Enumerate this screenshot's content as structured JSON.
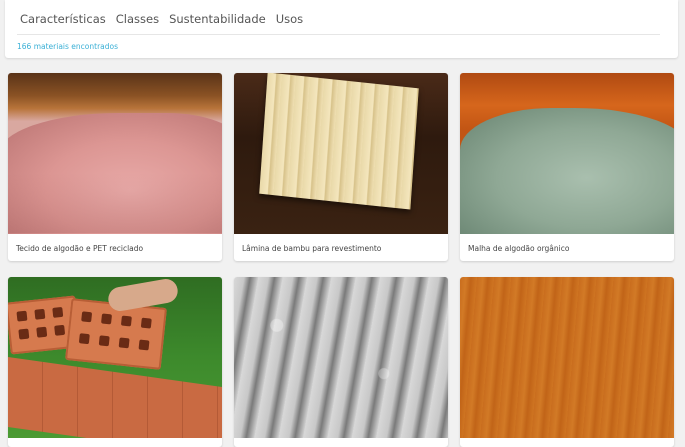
{
  "nav": {
    "tabs": [
      "Características",
      "Classes",
      "Sustentabilidade",
      "Usos"
    ],
    "count_text": "166 materiais encontrados"
  },
  "cards": [
    {
      "label": "Tecido de algodão e PET reciclado",
      "image": "pink-fabric"
    },
    {
      "label": "Lâmina de bambu para revestimento",
      "image": "bamboo-sheet"
    },
    {
      "label": "Malha de algodão orgânico",
      "image": "green-fabric"
    },
    {
      "label": "",
      "image": "ceramic-bricks"
    },
    {
      "label": "",
      "image": "textured-panel"
    },
    {
      "label": "",
      "image": "orange-wood"
    }
  ],
  "colors": {
    "accent": "#3bb0d6",
    "background": "#f1f1f1"
  }
}
